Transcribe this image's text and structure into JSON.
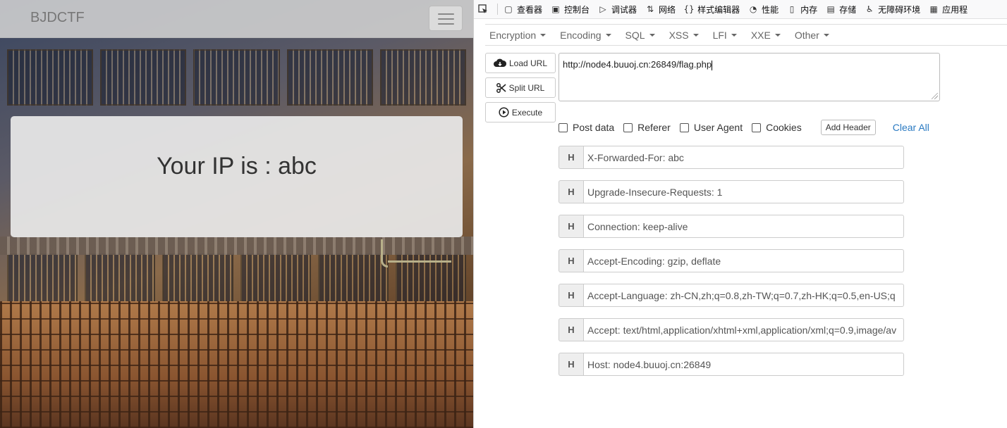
{
  "left_page": {
    "brand": "BJDCTF",
    "ip_message": "Your IP is : abc"
  },
  "devtools": {
    "tabs": [
      {
        "label": "查看器",
        "icon": "inspector-icon"
      },
      {
        "label": "控制台",
        "icon": "console-icon"
      },
      {
        "label": "调试器",
        "icon": "debugger-icon"
      },
      {
        "label": "网络",
        "icon": "network-icon"
      },
      {
        "label": "样式编辑器",
        "icon": "style-editor-icon"
      },
      {
        "label": "性能",
        "icon": "performance-icon"
      },
      {
        "label": "内存",
        "icon": "memory-icon"
      },
      {
        "label": "存储",
        "icon": "storage-icon"
      },
      {
        "label": "无障碍环境",
        "icon": "accessibility-icon"
      },
      {
        "label": "应用程",
        "icon": "application-icon"
      }
    ]
  },
  "hackbar": {
    "menu": [
      "Encryption",
      "Encoding",
      "SQL",
      "XSS",
      "LFI",
      "XXE",
      "Other"
    ],
    "buttons": {
      "load_url": "Load URL",
      "split_url": "Split URL",
      "execute": "Execute"
    },
    "url": "http://node4.buuoj.cn:26849/flag.php",
    "options": {
      "post_data": "Post data",
      "referer": "Referer",
      "user_agent": "User Agent",
      "cookies": "Cookies",
      "add_header": "Add Header",
      "clear_all": "Clear All"
    },
    "header_badge": "H",
    "headers": [
      "X-Forwarded-For: abc",
      "Upgrade-Insecure-Requests: 1",
      "Connection: keep-alive",
      "Accept-Encoding: gzip, deflate",
      "Accept-Language: zh-CN,zh;q=0.8,zh-TW;q=0.7,zh-HK;q=0.5,en-US;q",
      "Accept: text/html,application/xhtml+xml,application/xml;q=0.9,image/av",
      "Host: node4.buuoj.cn:26849"
    ]
  }
}
